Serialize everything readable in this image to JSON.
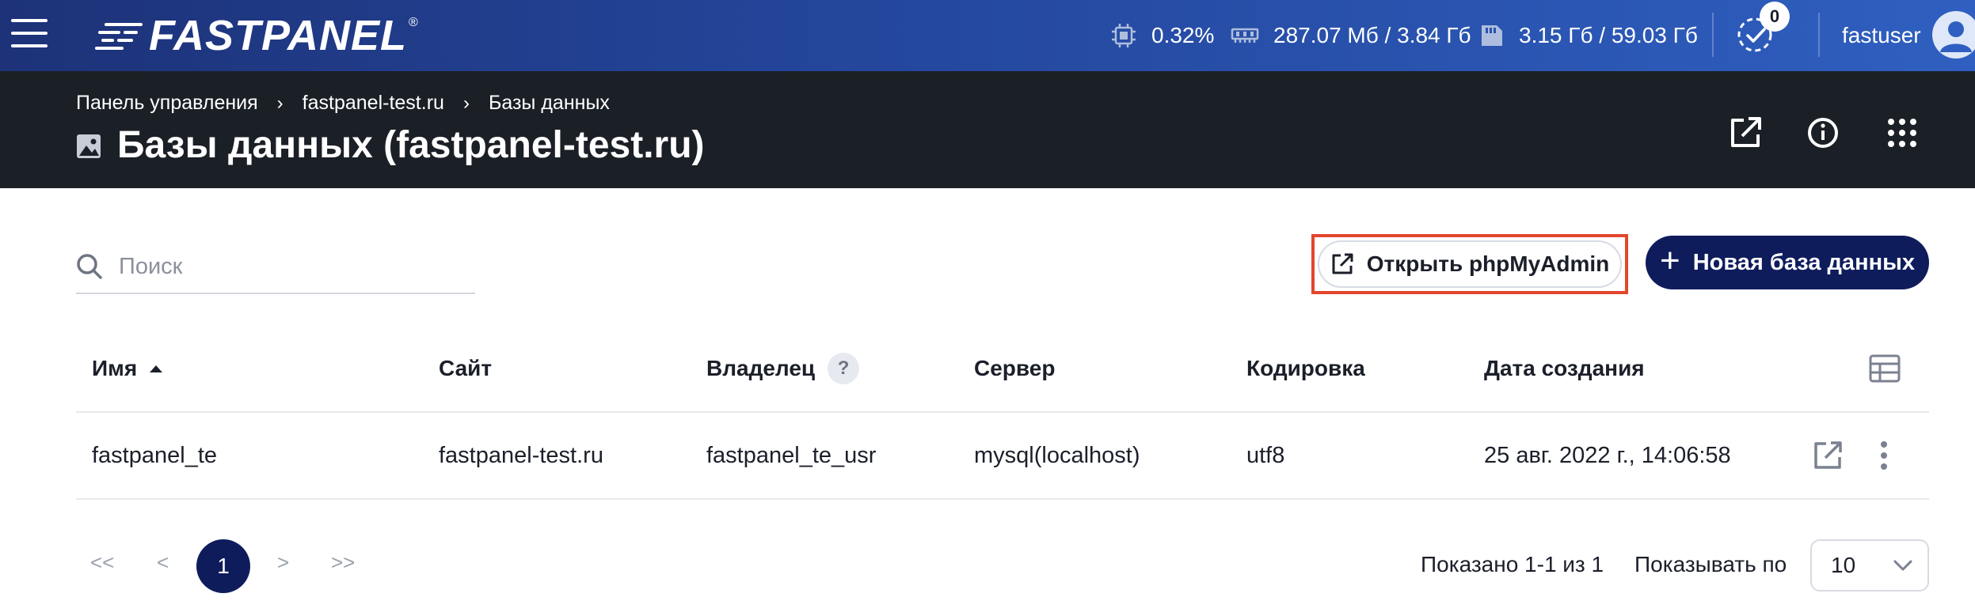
{
  "topbar": {
    "logo": "FASTPANEL",
    "logo_reg": "®",
    "cpu": "0.32%",
    "ram": "287.07 Мб / 3.84 Гб",
    "disk": "3.15 Гб / 59.03 Гб",
    "tasks_count": "0",
    "username": "fastuser"
  },
  "breadcrumb": [
    "Панель управления",
    "fastpanel-test.ru",
    "Базы данных"
  ],
  "page_title": "Базы данных (fastpanel-test.ru)",
  "search": {
    "placeholder": "Поиск",
    "value": ""
  },
  "buttons": {
    "open_phpmyadmin": "Открыть phpMyAdmin",
    "new_database": "Новая база данных"
  },
  "table": {
    "columns": [
      "Имя",
      "Сайт",
      "Владелец",
      "Сервер",
      "Кодировка",
      "Дата создания"
    ],
    "help_mark": "?",
    "rows": [
      [
        "fastpanel_te",
        "fastpanel-test.ru",
        "fastpanel_te_usr",
        "mysql(localhost)",
        "utf8",
        "25 авг. 2022 г., 14:06:58"
      ]
    ]
  },
  "pagination": {
    "first": "<<",
    "prev": "<",
    "current": "1",
    "next": ">",
    "last": ">>",
    "shown": "Показано 1-1 из 1",
    "per_page_label": "Показывать по",
    "per_page_value": "10"
  },
  "colors": {
    "topbar_start": "#1d3278",
    "topbar_end": "#2f5fc0",
    "header_bg": "#1b1f26",
    "primary": "#0f1c5c",
    "highlight": "#e2462c"
  }
}
